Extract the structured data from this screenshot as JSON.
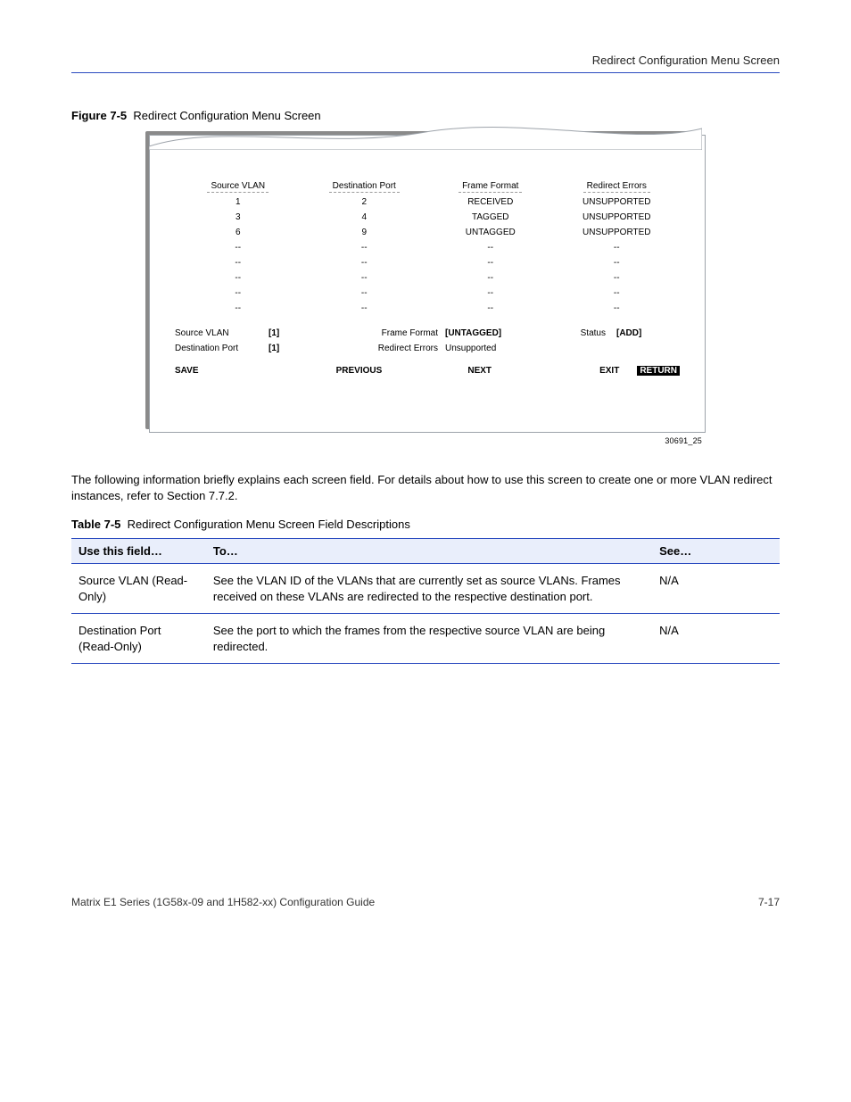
{
  "header": {
    "right": "Redirect Configuration Menu Screen"
  },
  "fig": {
    "label": "Figure 7-5",
    "title": "Redirect Configuration Menu Screen",
    "columns": [
      "Source VLAN",
      "Destination Port",
      "Frame Format",
      "Redirect Errors"
    ],
    "rows": [
      [
        "1",
        "2",
        "RECEIVED",
        "UNSUPPORTED"
      ],
      [
        "3",
        "4",
        "TAGGED",
        "UNSUPPORTED"
      ],
      [
        "6",
        "9",
        "UNTAGGED",
        "UNSUPPORTED"
      ],
      [
        "--",
        "--",
        "--",
        "--"
      ],
      [
        "--",
        "--",
        "--",
        "--"
      ],
      [
        "--",
        "--",
        "--",
        "--"
      ],
      [
        "--",
        "--",
        "--",
        "--"
      ],
      [
        "--",
        "--",
        "--",
        "--"
      ]
    ],
    "inputs": {
      "sourceVlanLabel": "Source VLAN",
      "sourceVlanValue": "[1]",
      "frameFormatLabel": "Frame Format",
      "frameFormatValue": "[UNTAGGED]",
      "statusLabel": "Status",
      "statusValue": "[ADD]",
      "destPortLabel": "Destination Port",
      "destPortValue": "[1]",
      "redirectErrorsLabel": "Redirect Errors",
      "redirectErrorsValue": "Unsupported"
    },
    "buttons": {
      "save": "SAVE",
      "previous": "PREVIOUS",
      "next": "NEXT",
      "exit": "EXIT",
      "return": "RETURN"
    },
    "id": "30691_25"
  },
  "body": {
    "para": "The following information briefly explains each screen field. For details about how to use this screen to create one or more VLAN redirect instances, refer to Section 7.7.2."
  },
  "table": {
    "label": "Table 7-5",
    "title": "Redirect Configuration Menu Screen Field Descriptions",
    "head": [
      "Use this field…",
      "To…",
      "See…"
    ],
    "row1": {
      "a": "Source VLAN (Read-Only)",
      "b": "See the VLAN ID of the VLANs that are currently set as source VLANs. Frames received on these VLANs are redirected to the respective destination port.",
      "c": "N/A"
    },
    "row2": {
      "a": "Destination Port (Read-Only)",
      "b": "See the port to which the frames from the respective source VLAN are being redirected.",
      "c": "N/A"
    }
  },
  "footer": {
    "left": "Matrix E1 Series (1G58x-09 and 1H582-xx) Configuration Guide",
    "right": "7-17"
  }
}
